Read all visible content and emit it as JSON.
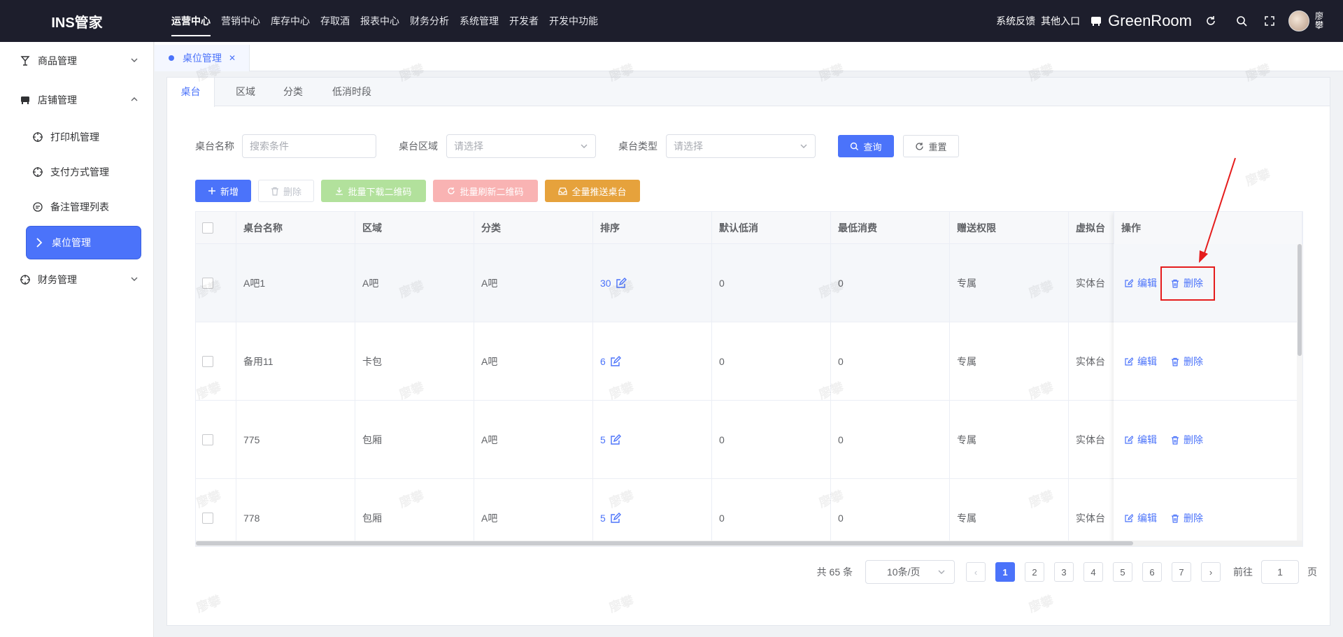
{
  "app": {
    "brand": "INS管家"
  },
  "topnav": {
    "items": [
      "运营中心",
      "营销中心",
      "库存中心",
      "存取酒",
      "报表中心",
      "财务分析",
      "系统管理",
      "开发者",
      "开发中功能"
    ],
    "active": "运营中心"
  },
  "topright": {
    "feedback": "系统反馈",
    "other": "其他入口",
    "store": "GreenRoom",
    "user": "廖攀"
  },
  "sidebar": {
    "groups": [
      {
        "label": "商品管理",
        "icon": "goblet-icon",
        "expanded": false
      },
      {
        "label": "店铺管理",
        "icon": "store-icon",
        "expanded": true
      },
      {
        "label": "财务管理",
        "icon": "finance-icon",
        "expanded": false
      }
    ],
    "sub": [
      "打印机管理",
      "支付方式管理",
      "备注管理列表",
      "桌位管理"
    ],
    "active": "桌位管理"
  },
  "pagetab": {
    "label": "桌位管理"
  },
  "tabs": {
    "items": [
      "桌台",
      "区域",
      "分类",
      "低消时段"
    ],
    "active": "桌台"
  },
  "filters": {
    "name_label": "桌台名称",
    "name_placeholder": "搜索条件",
    "area_label": "桌台区域",
    "area_placeholder": "请选择",
    "type_label": "桌台类型",
    "type_placeholder": "请选择",
    "query": "查询",
    "reset": "重置"
  },
  "toolbar": {
    "add": "新增",
    "delete": "删除",
    "download_qr": "批量下载二维码",
    "refresh_qr": "批量刷新二维码",
    "push_all": "全量推送桌台"
  },
  "table": {
    "columns": [
      "桌台名称",
      "区域",
      "分类",
      "排序",
      "默认低消",
      "最低消费",
      "赠送权限",
      "虚拟台",
      "操作"
    ],
    "rows": [
      {
        "name": "A吧1",
        "area": "A吧",
        "category": "A吧",
        "sort": "30",
        "default_min": "0",
        "min_spend": "0",
        "gift": "专属",
        "virtual": "实体台"
      },
      {
        "name": "备用11",
        "area": "卡包",
        "category": "A吧",
        "sort": "6",
        "default_min": "0",
        "min_spend": "0",
        "gift": "专属",
        "virtual": "实体台"
      },
      {
        "name": "775",
        "area": "包厢",
        "category": "A吧",
        "sort": "5",
        "default_min": "0",
        "min_spend": "0",
        "gift": "专属",
        "virtual": "实体台"
      },
      {
        "name": "778",
        "area": "包厢",
        "category": "A吧",
        "sort": "5",
        "default_min": "0",
        "min_spend": "0",
        "gift": "专属",
        "virtual": "实体台"
      }
    ],
    "edit": "编辑",
    "delete": "删除"
  },
  "pagination": {
    "total": "共 65 条",
    "page_size": "10条/页",
    "pages": [
      "1",
      "2",
      "3",
      "4",
      "5",
      "6",
      "7"
    ],
    "current": "1",
    "goto_label": "前往",
    "goto_value": "1",
    "page_unit": "页"
  },
  "watermark": "廖攀",
  "colors": {
    "accent": "#4b73fa",
    "topbar": "#1d1e2c",
    "highlight": "#e51c1c"
  }
}
